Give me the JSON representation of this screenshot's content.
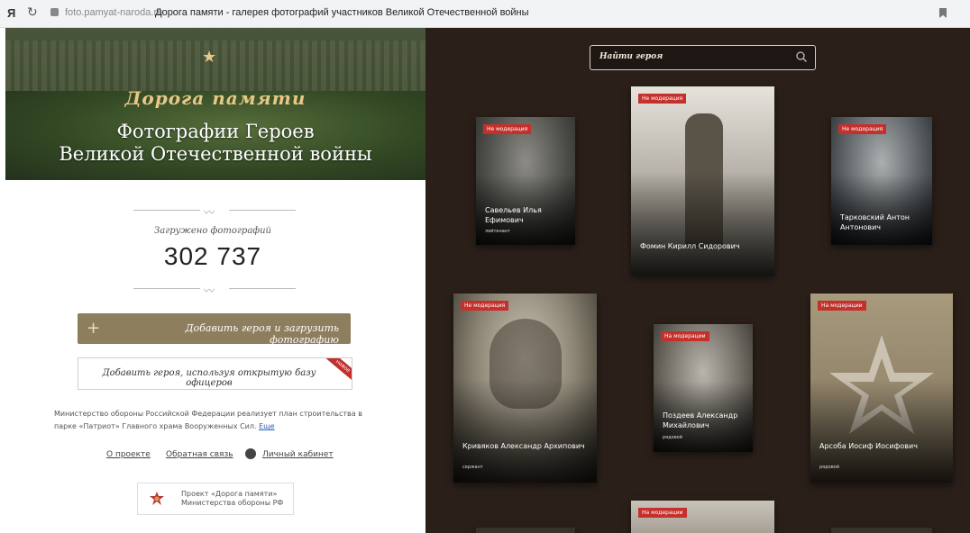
{
  "browser": {
    "brand": "Я",
    "url": "foto.pamyat-naroda.ru",
    "page_title": "Дорога памяти - галерея фотографий участников Великой Отечественной войны"
  },
  "hero": {
    "logo": "Дорога памяти",
    "title_line1": "Фотографии Героев",
    "title_line2": "Великой Отечественной войны"
  },
  "stats": {
    "label": "Загружено фотографий",
    "count": "302 737"
  },
  "buttons": {
    "add_hero": "Добавить героя и загрузить фотографию",
    "add_officer": "Добавить героя, используя открытую базу офицеров",
    "ribbon": "новое"
  },
  "description": {
    "text": "Министерство обороны Российской Федерации реализует план строительства в парке «Патриот» Главного храма Вооруженных Сил.",
    "more": "Еще"
  },
  "footer_links": {
    "about": "О проекте",
    "feedback": "Обратная связь",
    "cabinet": "Личный кабинет"
  },
  "ministry": {
    "line1": "Проект «Дорога памяти»",
    "line2": "Министерства обороны РФ"
  },
  "search": {
    "placeholder": "Найти героя"
  },
  "cards": [
    {
      "badge": "Не модерация",
      "name": "Савельев Илья Ефимович",
      "rank": "лейтенант"
    },
    {
      "badge": "Не модерация",
      "name": "Фомин Кирилл Сидорович",
      "rank": ""
    },
    {
      "badge": "Не модерация",
      "name": "Тарковский Антон Антонович",
      "rank": ""
    },
    {
      "badge": "Не модерация",
      "name": "Кривяков Александр Архипович",
      "rank": "сержант"
    },
    {
      "badge": "На модерации",
      "name": "Поздеев Александр Михайлович",
      "rank": "рядовой"
    },
    {
      "badge": "На модерации",
      "name": "Арсоба Иосиф Иосифович",
      "rank": "рядовой"
    },
    {
      "badge": "На модерации",
      "name": "",
      "rank": ""
    }
  ],
  "colors": {
    "gallery_bg": "#2b1f19",
    "badge_red": "#c4302b",
    "button_brown": "#8d7e5e"
  }
}
